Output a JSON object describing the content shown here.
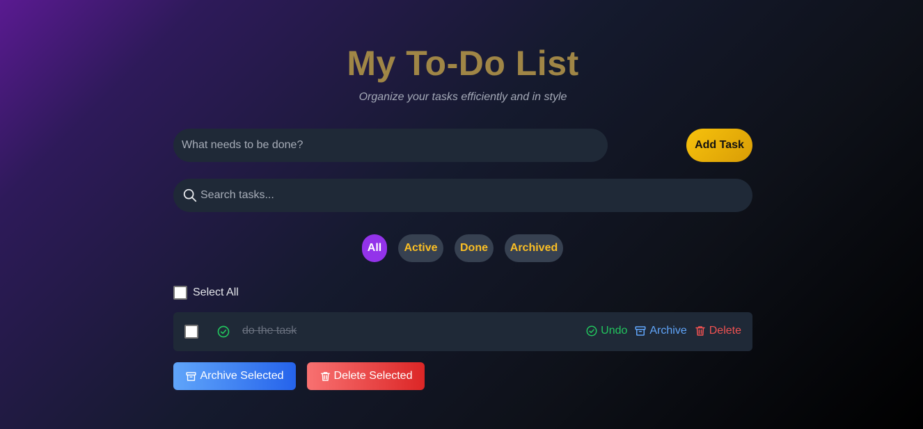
{
  "header": {
    "title": "My To-Do List",
    "subtitle": "Organize your tasks efficiently and in style"
  },
  "new_task": {
    "placeholder": "What needs to be done?",
    "value": "",
    "add_label": "Add Task"
  },
  "search": {
    "placeholder": "Search tasks...",
    "value": "",
    "icon": "search-icon"
  },
  "filters": {
    "selected": "All",
    "items": [
      {
        "label": "All"
      },
      {
        "label": "Active"
      },
      {
        "label": "Done"
      },
      {
        "label": "Archived"
      }
    ]
  },
  "select_all": {
    "label": "Select All",
    "checked": false
  },
  "tasks": [
    {
      "text": "do the task",
      "completed": true,
      "checked": false,
      "actions": {
        "undo": "Undo",
        "archive": "Archive",
        "delete": "Delete"
      }
    }
  ],
  "bulk_actions": {
    "archive_label": "Archive Selected",
    "delete_label": "Delete Selected"
  },
  "colors": {
    "title": "#a08646",
    "accent_purple": "#9333ea",
    "filter_text": "#fbbf24",
    "add_button": "#f7c20c",
    "undo": "#22c55e",
    "archive": "#60a5fa",
    "delete": "#f05252"
  }
}
